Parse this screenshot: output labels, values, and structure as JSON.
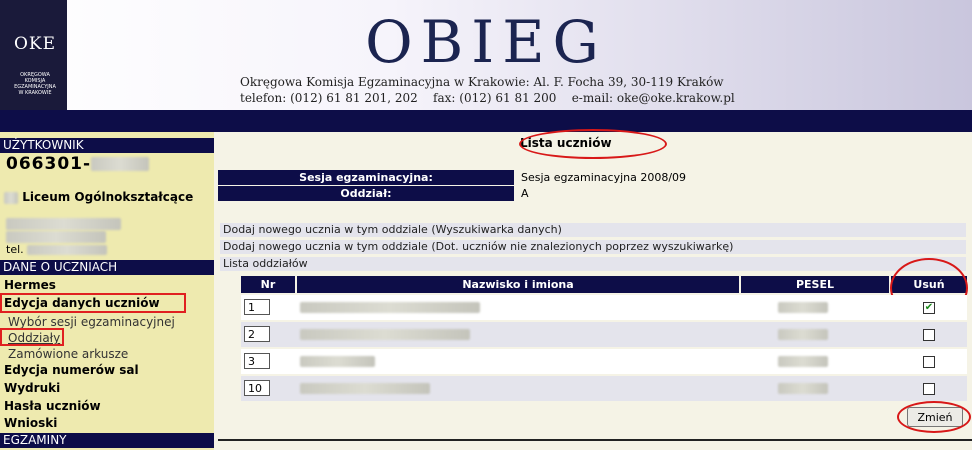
{
  "header": {
    "logo_text": "OKE",
    "logo_caption": "OKRĘGOWA KOMISJA EGZAMINACYJNA W KRAKOWIE",
    "app_title": "OBIEG",
    "address_line": "Okręgowa Komisja Egzaminacyjna w Krakowie: Al. F. Focha 39, 30-119 Kraków",
    "contact_line": "telefon: (012) 61 81 201, 202    fax: (012) 61 81 200    e-mail: oke@oke.krakow.pl"
  },
  "sidebar": {
    "user_heading": "UŻYTKOWNIK",
    "user_id": "066301-",
    "school_name": "Liceum Ogólnokształcące",
    "phone_prefix": "tel.",
    "section_students": "DANE O UCZNIACH",
    "items": [
      {
        "label": "Hermes",
        "level": "main"
      },
      {
        "label": "Edycja danych uczniów",
        "level": "main",
        "highlighted": true
      },
      {
        "label": "Wybór sesji egzaminacyjnej",
        "level": "sub"
      },
      {
        "label": "Oddziały",
        "level": "sub",
        "highlighted": true
      },
      {
        "label": "Zamówione arkusze",
        "level": "sub"
      },
      {
        "label": "Edycja numerów sal",
        "level": "main"
      },
      {
        "label": "Wydruki",
        "level": "main"
      },
      {
        "label": "Hasła uczniów",
        "level": "main"
      },
      {
        "label": "Wnioski",
        "level": "main"
      }
    ],
    "section_exams": "EGZAMINY"
  },
  "main": {
    "title": "Lista uczniów",
    "session_label": "Sesja egzaminacyjna:",
    "session_value": "Sesja egzaminacyjna 2008/09",
    "class_label": "Oddział:",
    "class_value": "A",
    "links": [
      "Dodaj nowego ucznia w tym oddziale (Wyszukiwarka danych)",
      "Dodaj nowego ucznia w tym oddziale (Dot. uczniów nie znalezionych poprzez wyszukiwarkę)",
      "Lista oddziałów"
    ],
    "table": {
      "headers": {
        "nr": "Nr",
        "name": "Nazwisko i imiona",
        "pesel": "PESEL",
        "delete": "Usuń"
      },
      "rows": [
        {
          "nr": "1",
          "checked": true
        },
        {
          "nr": "2",
          "checked": false
        },
        {
          "nr": "3",
          "checked": false
        },
        {
          "nr": "10",
          "checked": false
        }
      ]
    },
    "submit_label": "Zmień"
  },
  "colors": {
    "navy": "#0d0d48",
    "sidebar_bg": "#eeeaaf",
    "highlight_red": "#e02020"
  }
}
